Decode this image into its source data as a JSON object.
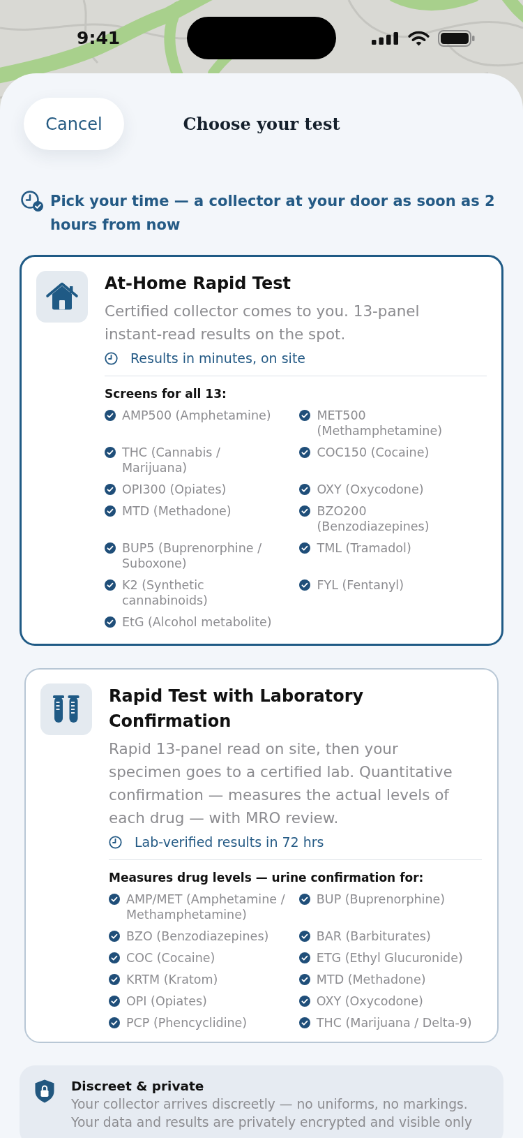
{
  "status_bar": {
    "time": "9:41"
  },
  "header": {
    "cancel": "Cancel",
    "title": "Choose your test"
  },
  "time_banner": "Pick your time — a collector at your door as soon as 2 hours from now",
  "test_options": [
    {
      "title": "At-Home Rapid Test",
      "selected": true,
      "description": "Certified collector comes to you. 13-panel instant-read results on the spot.",
      "turnaround": "Results in minutes, on site",
      "list_heading": "Screens for all 13:",
      "items": [
        "AMP500 (Amphetamine)",
        "MET500 (Methamphetamine)",
        "THC (Cannabis / Marijuana)",
        "COC150 (Cocaine)",
        "OPI300 (Opiates)",
        "OXY (Oxycodone)",
        "MTD (Methadone)",
        "BZO200 (Benzodiazepines)",
        "BUP5 (Buprenorphine / Suboxone)",
        "TML (Tramadol)",
        "K2 (Synthetic cannabinoids)",
        "FYL (Fentanyl)",
        "EtG (Alcohol metabolite)"
      ]
    },
    {
      "title": "Rapid Test with Laboratory Confirmation",
      "selected": false,
      "description": "Rapid 13-panel read on site, then your specimen goes to a certified lab. Quantitative confirmation — measures the actual levels of each drug — with MRO review.",
      "turnaround": "Lab-verified results in 72 hrs",
      "list_heading": "Measures drug levels — urine confirmation for:",
      "items": [
        "AMP/MET (Amphetamine / Methamphetamine)",
        "BUP (Buprenorphine)",
        "BZO (Benzodiazepines)",
        "BAR (Barbiturates)",
        "COC (Cocaine)",
        "ETG (Ethyl Glucuronide)",
        "KRTM (Kratom)",
        "MTD (Methadone)",
        "OPI (Opiates)",
        "OXY (Oxycodone)",
        "PCP (Phencyclidine)",
        "THC (Marijuana / Delta-9)"
      ]
    }
  ],
  "privacy_note": {
    "title": "Discreet & private",
    "text": "Your collector arrives discreetly — no uniforms, no markings. Your data and results are privately encrypted and visible only"
  }
}
